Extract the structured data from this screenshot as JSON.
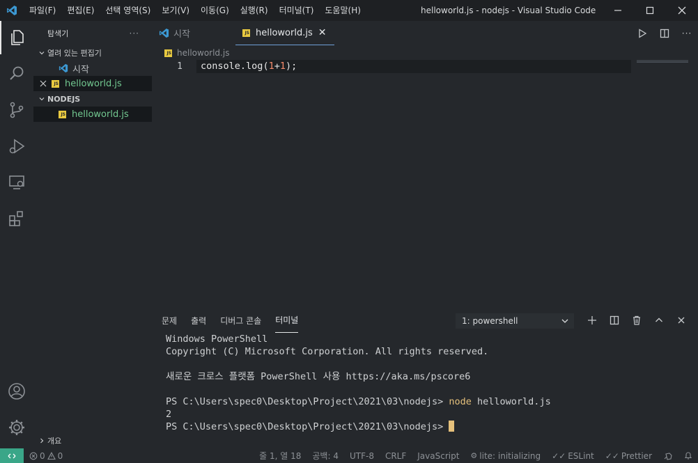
{
  "titlebar": {
    "title": "helloworld.js - nodejs - Visual Studio Code",
    "menu": [
      "파일(F)",
      "편집(E)",
      "선택 영역(S)",
      "보기(V)",
      "이동(G)",
      "실행(R)",
      "터미널(T)",
      "도움말(H)"
    ]
  },
  "sidebar": {
    "title": "탐색기",
    "more": "···",
    "open_editors_label": "열려 있는 편집기",
    "open_editors": [
      {
        "name": "시작",
        "icon": "vscode-icon"
      },
      {
        "name": "helloworld.js",
        "icon": "js-file-icon"
      }
    ],
    "folder_label": "NODEJS",
    "folder_files": [
      {
        "name": "helloworld.js",
        "icon": "js-file-icon"
      }
    ],
    "outline_label": "개요"
  },
  "tabs": [
    {
      "label": "시작",
      "active": false
    },
    {
      "label": "helloworld.js",
      "active": true
    }
  ],
  "breadcrumb": "helloworld.js",
  "editor": {
    "line_number": "1",
    "code": {
      "obj": "console",
      "dot": ".",
      "fn": "log",
      "open": "(",
      "a": "1",
      "op": "+",
      "b": "1",
      "close": ");"
    }
  },
  "panel": {
    "tabs": [
      "문제",
      "출력",
      "디버그 콘솔",
      "터미널"
    ],
    "active_tab": "터미널",
    "terminal_select": "1: powershell",
    "terminal": {
      "line1": "Windows PowerShell",
      "line2": "Copyright (C) Microsoft Corporation. All rights reserved.",
      "line3": "새로운 크로스 플랫폼 PowerShell 사용 https://aka.ms/pscore6",
      "prompt": "PS C:\\Users\\spec0\\Desktop\\Project\\2021\\03\\nodejs> ",
      "command": "node",
      "command_arg": " helloworld.js",
      "output": "2"
    }
  },
  "statusbar": {
    "errors": "0",
    "warnings": "0",
    "position": "줄 1, 열 18",
    "spaces": "공백: 4",
    "encoding": "UTF-8",
    "eol": "CRLF",
    "language": "JavaScript",
    "tslint": "lite: initializing",
    "eslint": "ESLint",
    "prettier": "Prettier"
  },
  "colors": {
    "accent": "#3aa688",
    "js_badge": "#e8c940",
    "vscode_blue": "#3c99d4"
  }
}
